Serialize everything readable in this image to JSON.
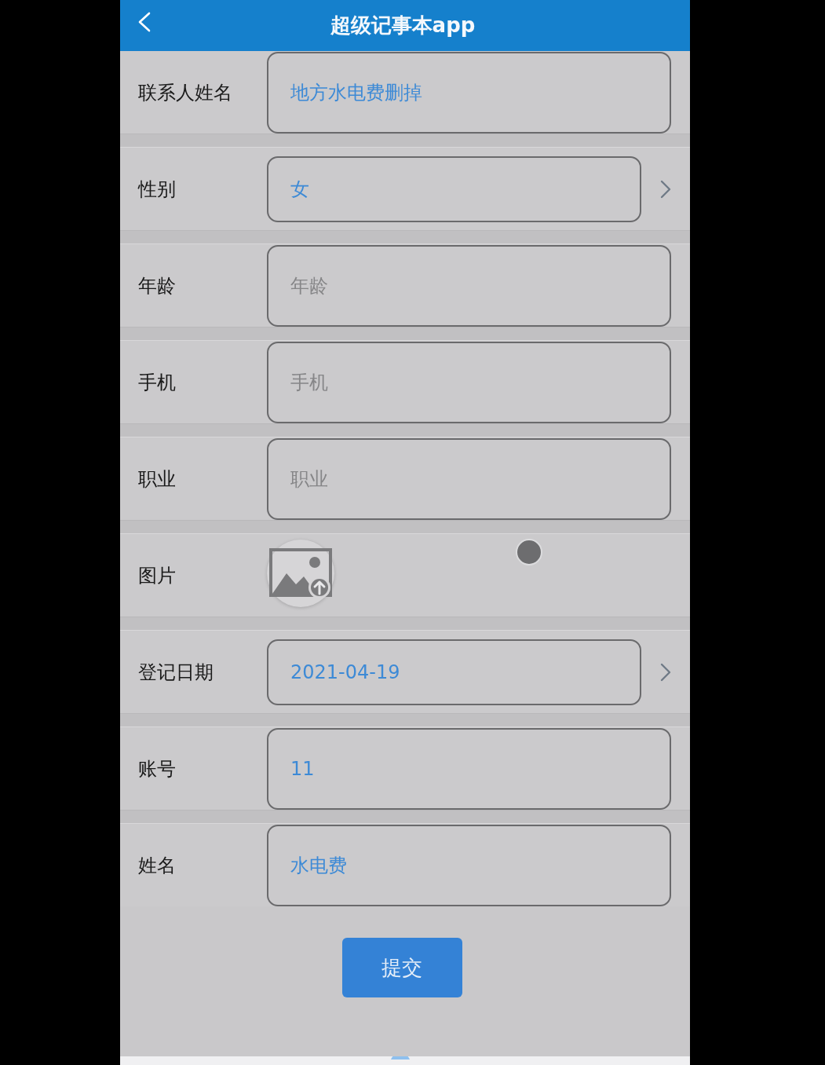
{
  "header": {
    "title": "超级记事本app"
  },
  "form": [
    {
      "kind": "text",
      "label": "联系人姓名",
      "value": "地方水电费删掉"
    },
    {
      "kind": "picker",
      "label": "性别",
      "value": "女"
    },
    {
      "kind": "text",
      "label": "年龄",
      "placeholder": "年龄"
    },
    {
      "kind": "text",
      "label": "手机",
      "placeholder": "手机"
    },
    {
      "kind": "text",
      "label": "职业",
      "placeholder": "职业"
    },
    {
      "kind": "image",
      "label": "图片"
    },
    {
      "kind": "picker",
      "label": "登记日期",
      "value": "2021-04-19"
    },
    {
      "kind": "text",
      "label": "账号",
      "value": "11"
    },
    {
      "kind": "text",
      "label": "姓名",
      "value": "水电费"
    }
  ],
  "submit_button": {
    "label": "提交"
  }
}
